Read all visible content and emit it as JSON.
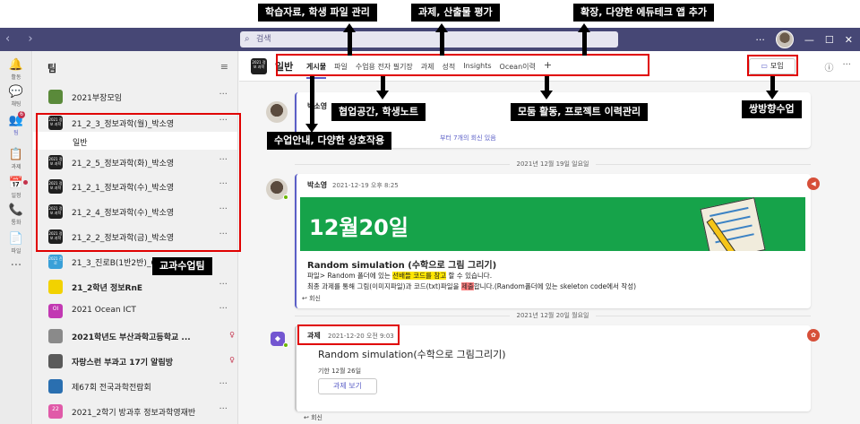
{
  "topbar": {
    "search_placeholder": "검색",
    "more": "···"
  },
  "rail": [
    {
      "icon": "bell-icon",
      "glyph": "🔔",
      "label": "활동"
    },
    {
      "icon": "chat-icon",
      "glyph": "💬",
      "label": "채팅"
    },
    {
      "icon": "teams-icon",
      "glyph": "👥",
      "label": "팀",
      "badge": "6"
    },
    {
      "icon": "assignment-icon",
      "glyph": "📋",
      "label": "과제"
    },
    {
      "icon": "calendar-icon",
      "glyph": "📅",
      "label": "일정"
    },
    {
      "icon": "calls-icon",
      "glyph": "📞",
      "label": "통화"
    },
    {
      "icon": "files-icon",
      "glyph": "📄",
      "label": "파일"
    },
    {
      "icon": "more-apps-icon",
      "glyph": "···",
      "label": ""
    }
  ],
  "teams_panel": {
    "title": "팀",
    "teams": [
      {
        "name": "2021부장모임",
        "color": "#5a8a3a",
        "tile": "",
        "bold": false
      },
      {
        "name": "21_2_3_정보과학(월)_박소영",
        "color": "#1f1f1f",
        "tile": "2021 정보 과학",
        "bold": false
      },
      {
        "name": "21_2_5_정보과학(화)_박소영",
        "color": "#1f1f1f",
        "tile": "2021 정보 과학",
        "bold": false
      },
      {
        "name": "21_2_1_정보과학(수)_박소영",
        "color": "#1f1f1f",
        "tile": "2021 정보 과학",
        "bold": false
      },
      {
        "name": "21_2_4_정보과학(수)_박소영",
        "color": "#1f1f1f",
        "tile": "2021 정보 과학",
        "bold": false
      },
      {
        "name": "21_2_2_정보과학(금)_박소영",
        "color": "#1f1f1f",
        "tile": "2021 정보 과학",
        "bold": false
      },
      {
        "name": "21_3_진로B(1반2반)_Oce",
        "color": "#3aa0d8",
        "tile": "2021 진로",
        "bold": false
      },
      {
        "name": "21_2학년 정보RnE",
        "color": "#f2d200",
        "tile": "",
        "bold": true
      },
      {
        "name": "2021 Ocean ICT",
        "color": "#c239b3",
        "tile": "OI",
        "bold": false
      },
      {
        "name": "2021학년도 부산과학고등학교 ...",
        "color": "#8a8a8a",
        "tile": "",
        "bold": true
      },
      {
        "name": "자랑스런 부과고 17기 알림방",
        "color": "#5a5a5a",
        "tile": "",
        "bold": true
      },
      {
        "name": "제67회 전국과학전람회",
        "color": "#2a6fb0",
        "tile": "",
        "bold": false
      },
      {
        "name": "2021_2학기 방과후 정보과학영재반",
        "color": "#e05aa8",
        "tile": "22",
        "bold": false
      }
    ],
    "channel": "일반"
  },
  "header": {
    "team_logo": "2021 정보 과학",
    "channel_name": "일반",
    "tabs": [
      "게시물",
      "파일",
      "수업용 전자 필기장",
      "과제",
      "성적",
      "Insights",
      "Ocean이력"
    ],
    "add_tab": "+",
    "meet_label": "모임"
  },
  "thread1": {
    "author": "박소영",
    "replies_text": "부터 7개의 회신 있음"
  },
  "date1": "2021년 12월 19일 일요일",
  "post": {
    "author": "박소영",
    "time": "2021-12-19 오후 8:25",
    "banner": "12월20일",
    "title": "Random simulation (수학으로 그림 그리기)",
    "line1_a": "파일> Random 폴더에 있는 ",
    "line1_hl": "선배들 코드를 참고",
    "line1_b": " 할 수 있습니다.",
    "line2_a": "최종 과제를 통해 그림(이미지파일)과 코드(txt)파일을 ",
    "line2_hl": "제출",
    "line2_b": "합니다.(Random폴더에 있는 skeleton code에서 작성)",
    "reply": "↩ 회신"
  },
  "date2": "2021년 12월 20일 월요일",
  "assignment": {
    "author": "과제",
    "time": "2021-12-20 오전 9:03",
    "title": "Random simulation(수학으로 그림그리기)",
    "due": "기한 12월 26일",
    "button": "과제 보기",
    "reply": "↩ 회신"
  },
  "annotations": {
    "files": "학습자료, 학생 파일 관리",
    "assign": "과제, 산출물 평가",
    "extend": "확장, 다양한 에듀테크 앱 추가",
    "notebook": "협업공간, 학생노트",
    "posts": "수업안내, 다양한 상호작용",
    "ocean": "모둠 활동, 프로젝트 이력관리",
    "meet": "쌍방향수업",
    "classes": "교과수업팀"
  }
}
